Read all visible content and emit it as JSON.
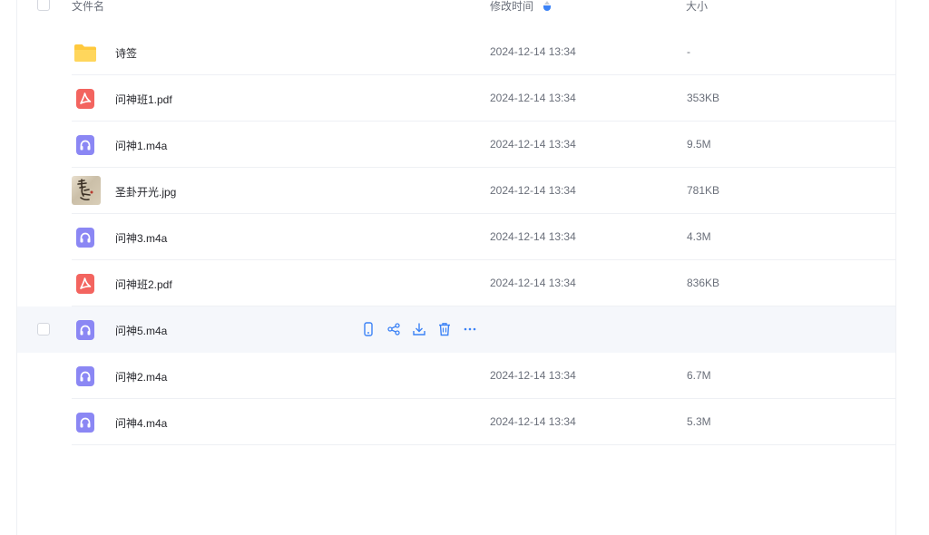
{
  "header": {
    "name_label": "文件名",
    "time_label": "修改时间",
    "size_label": "大小",
    "sort_indicator": "sort-desc-icon"
  },
  "colors": {
    "accent": "#3b82f6",
    "pdf": "#f3645f",
    "audio": "#8b87f4",
    "folder": "#ffc93d"
  },
  "files": [
    {
      "name": "诗签",
      "type": "folder",
      "time": "2024-12-14 13:34",
      "size": "-"
    },
    {
      "name": "问神班1.pdf",
      "type": "pdf",
      "time": "2024-12-14 13:34",
      "size": "353KB"
    },
    {
      "name": "问神1.m4a",
      "type": "audio",
      "time": "2024-12-14 13:34",
      "size": "9.5M"
    },
    {
      "name": "圣卦开光.jpg",
      "type": "image",
      "time": "2024-12-14 13:34",
      "size": "781KB"
    },
    {
      "name": "问神3.m4a",
      "type": "audio",
      "time": "2024-12-14 13:34",
      "size": "4.3M"
    },
    {
      "name": "问神班2.pdf",
      "type": "pdf",
      "time": "2024-12-14 13:34",
      "size": "836KB"
    },
    {
      "name": "问神5.m4a",
      "type": "audio",
      "time": "",
      "size": "",
      "hovered": true
    },
    {
      "name": "问神2.m4a",
      "type": "audio",
      "time": "2024-12-14 13:34",
      "size": "6.7M"
    },
    {
      "name": "问神4.m4a",
      "type": "audio",
      "time": "2024-12-14 13:34",
      "size": "5.3M"
    }
  ],
  "row_actions": [
    "phone-icon",
    "share-icon",
    "download-icon",
    "delete-icon",
    "more-icon"
  ]
}
